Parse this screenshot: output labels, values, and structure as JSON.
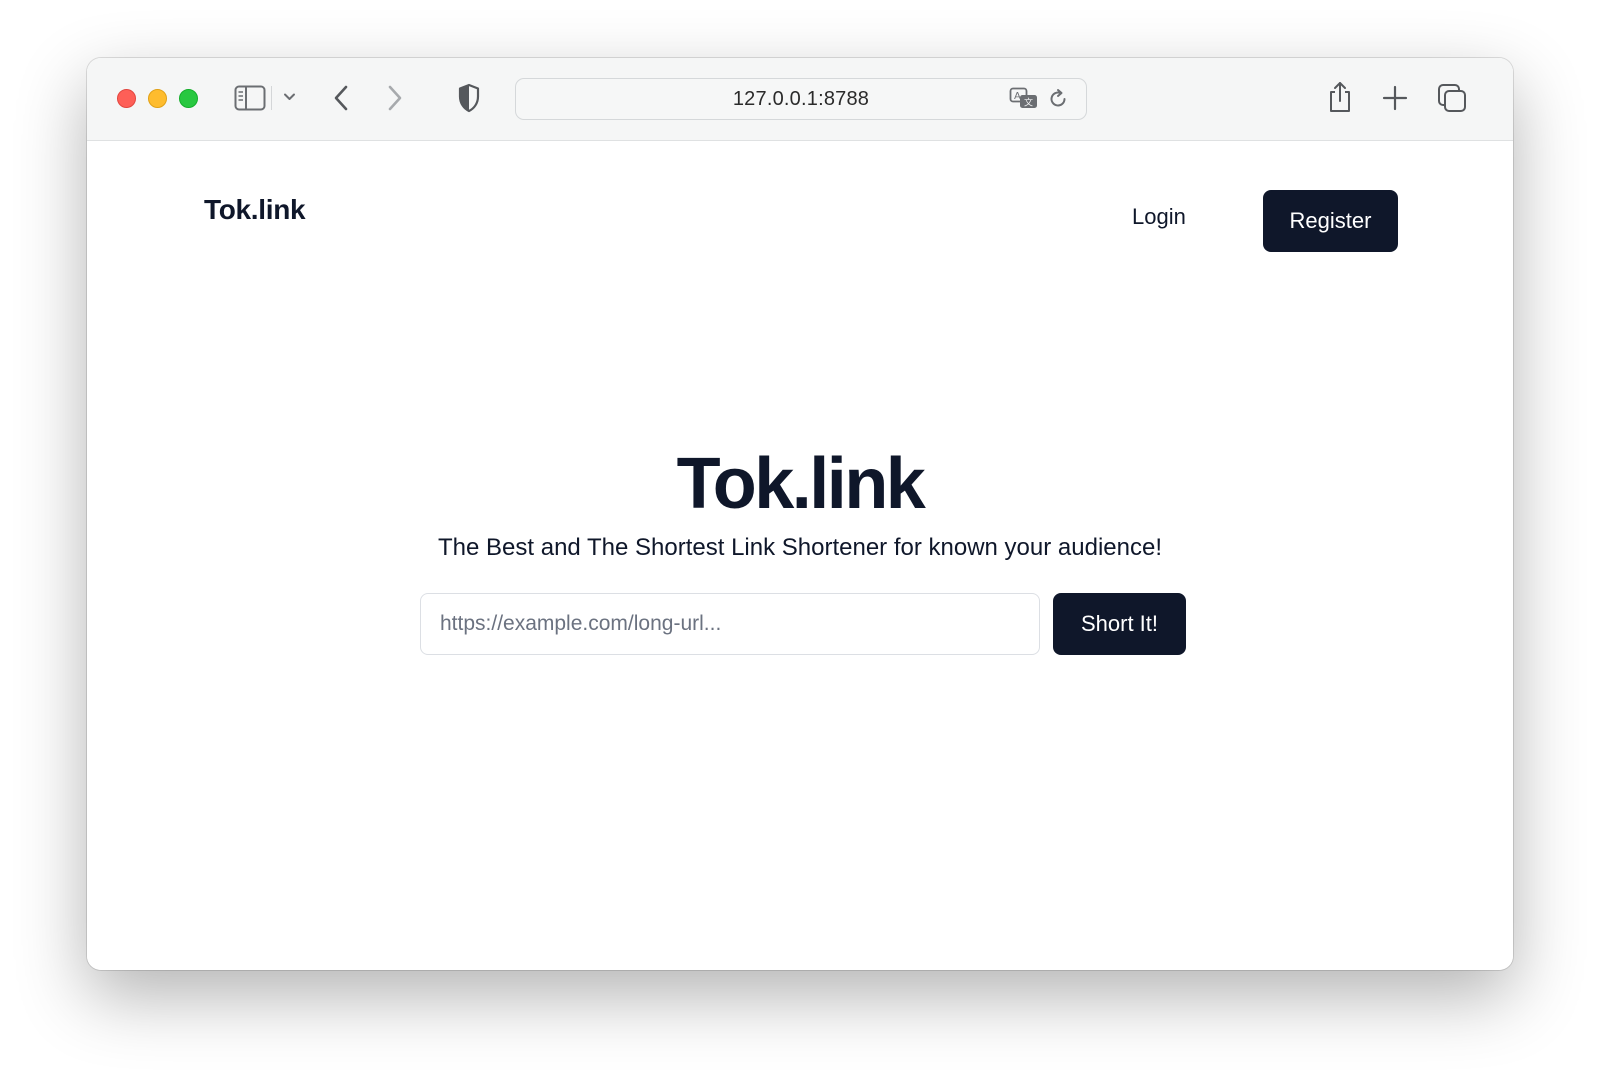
{
  "browser": {
    "url": "127.0.0.1:8788",
    "icons": {
      "sidebar": "sidebar-icon",
      "sidebar_menu": "chevron-down-icon",
      "back": "chevron-left-icon",
      "forward": "chevron-right-icon",
      "privacy": "shield-icon",
      "translate": "translate-icon",
      "reload": "reload-icon",
      "share": "share-icon",
      "new_tab": "plus-icon",
      "tabs": "tab-overview-icon"
    }
  },
  "navbar": {
    "brand": "Tok.link",
    "login_label": "Login",
    "register_label": "Register"
  },
  "hero": {
    "title": "Tok.link",
    "subtitle": "The Best and The Shortest Link Shortener for known your audience!",
    "input_placeholder": "https://example.com/long-url...",
    "input_value": "",
    "submit_label": "Short It!"
  },
  "colors": {
    "primary": "#0f172a",
    "text": "#0f172a",
    "placeholder": "#6b7280",
    "toolbar": "#f5f6f6"
  }
}
